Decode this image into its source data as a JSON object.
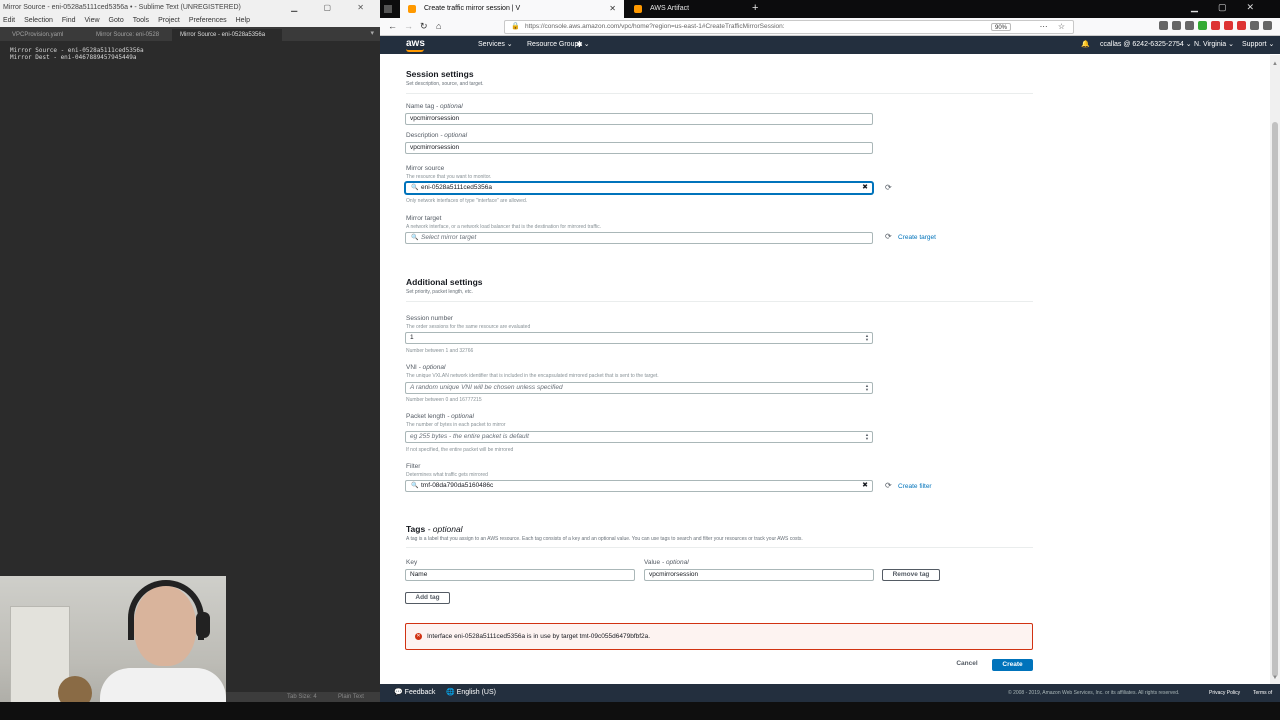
{
  "sublime": {
    "title": "Mirror Source - eni-0528a5111ced5356a • - Sublime Text (UNREGISTERED)",
    "menu": [
      "Edit",
      "Selection",
      "Find",
      "View",
      "Goto",
      "Tools",
      "Project",
      "Preferences",
      "Help"
    ],
    "tabs": [
      "VPCProvision.yaml",
      "Mirror Source: eni-0528",
      "Mirror Source - eni-0528a5356a"
    ],
    "editor_lines": [
      "Mirror Source - eni-0528a5111ced5356a",
      "Mirror Dest - eni-0467889457945449a"
    ],
    "status_tab_size": "Tab Size: 4",
    "status_syntax": "Plain Text"
  },
  "browser": {
    "tabs": [
      "Create traffic mirror session | V",
      "AWS Artifact"
    ],
    "url": "https://console.aws.amazon.com/vpc/home?region=us-east-1#CreateTrafficMirrorSession:",
    "zoom": "90%"
  },
  "aws_header": {
    "logo": "aws",
    "services": "Services ⌄",
    "resource_groups": "Resource Groups ⌄",
    "account": "ccallas @ 6242-6325-2754 ⌄",
    "region": "N. Virginia ⌄",
    "support": "Support ⌄"
  },
  "session_settings": {
    "title": "Session settings",
    "subtitle": "Set description, source, and target.",
    "name_tag_label": "Name tag",
    "name_tag_opt": "- optional",
    "name_tag_value": "vpcmirrorsession",
    "description_label": "Description",
    "description_opt": "- optional",
    "description_value": "vpcmirrorsession",
    "mirror_source_label": "Mirror source",
    "mirror_source_desc": "The resource that you want to monitor.",
    "mirror_source_value": "eni-0528a5111ced5356a",
    "mirror_source_hint": "Only network interfaces of type \"interface\" are allowed.",
    "mirror_target_label": "Mirror target",
    "mirror_target_desc": "A network interface, or a network load balancer that is the destination for mirrored traffic.",
    "mirror_target_placeholder": "Select mirror target",
    "create_target": "Create target"
  },
  "additional_settings": {
    "title": "Additional settings",
    "subtitle": "Set priority, packet length, etc.",
    "session_number_label": "Session number",
    "session_number_desc": "The order sessions for the same resource are evaluated",
    "session_number_value": "1",
    "session_number_hint": "Number between 1 and 32766",
    "vni_label": "VNI",
    "vni_opt": "- optional",
    "vni_desc": "The unique VXLAN network identifier that is included in the encapsulated mirrored packet that is sent to the target.",
    "vni_placeholder": "A random unique VNI will be chosen unless specified",
    "vni_hint": "Number between 0 and 16777215",
    "packet_length_label": "Packet length",
    "packet_length_opt": "- optional",
    "packet_length_desc": "The number of bytes in each packet to mirror",
    "packet_length_placeholder": "eg 255 bytes - the entire packet is default",
    "packet_length_hint": "If not specified, the entire packet will be mirrored",
    "filter_label": "Filter",
    "filter_desc": "Determines what traffic gets mirrored",
    "filter_value": "tmf-08da790da5160486c",
    "create_filter": "Create filter"
  },
  "tags": {
    "title": "Tags",
    "title_opt": "- optional",
    "subtitle": "A tag is a label that you assign to an AWS resource. Each tag consists of a key and an optional value. You can use tags to search and filter your resources or track your AWS costs.",
    "key_label": "Key",
    "value_label": "Value",
    "value_opt": "- optional",
    "key_value": "Name",
    "value_value": "vpcmirrorsession",
    "remove_tag": "Remove tag",
    "add_tag": "Add tag"
  },
  "error": {
    "message": "Interface eni-0528a5111ced5356a is in use by target tmt-09c055d6479bfbf2a."
  },
  "actions": {
    "cancel": "Cancel",
    "create": "Create"
  },
  "aws_footer": {
    "feedback": "Feedback",
    "language": "English (US)",
    "copyright": "© 2008 - 2019, Amazon Web Services, Inc. or its affiliates. All rights reserved.",
    "privacy": "Privacy Policy",
    "terms": "Terms of Use"
  }
}
